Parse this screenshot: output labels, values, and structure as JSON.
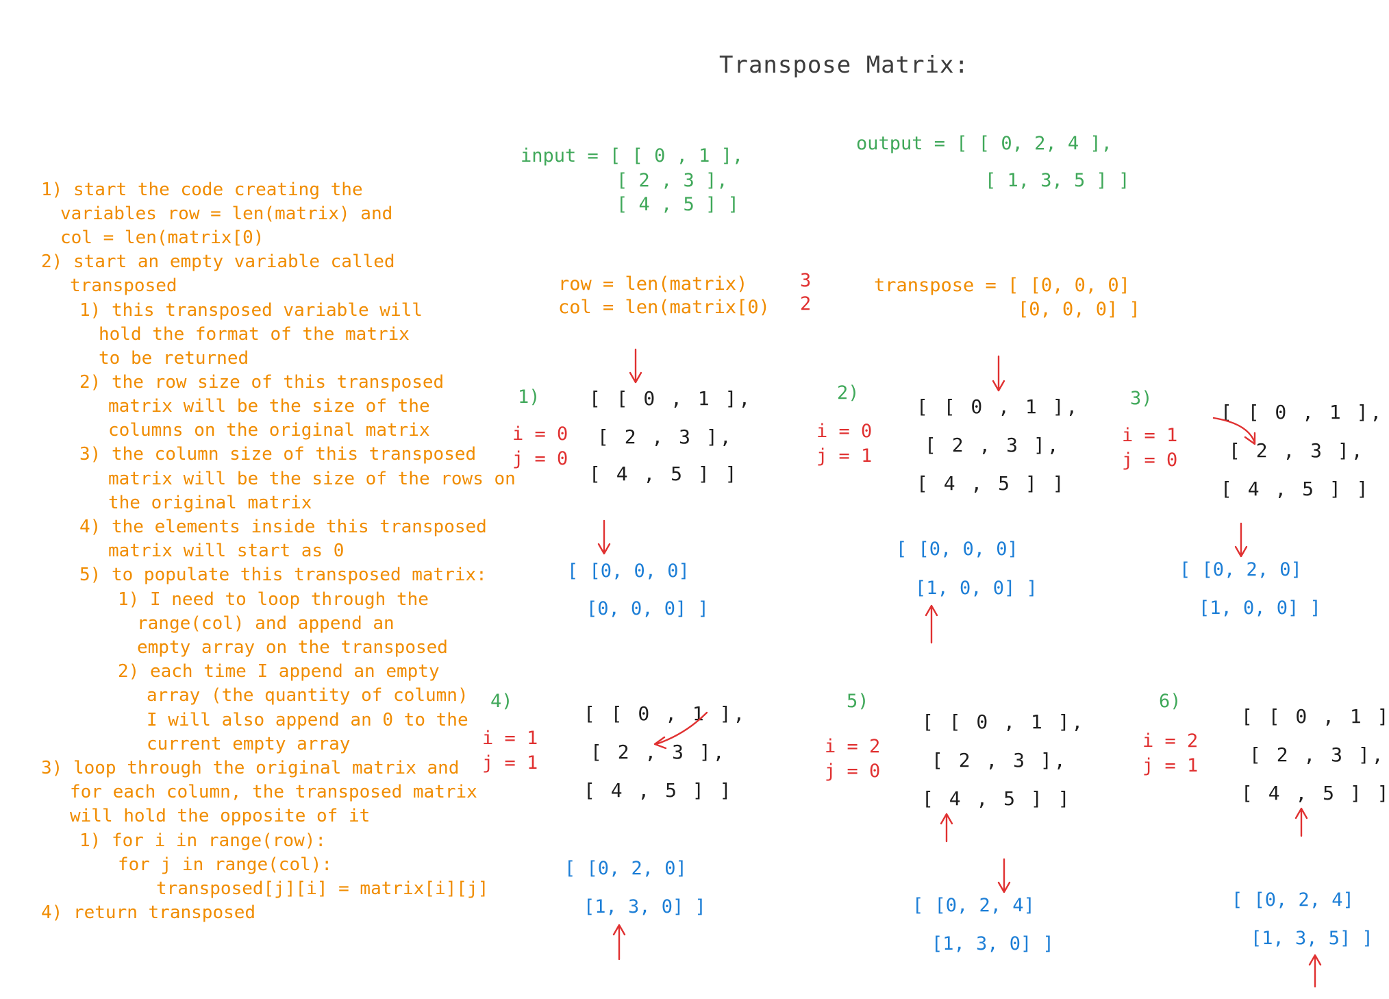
{
  "title": "Transpose Matrix:",
  "input": [
    "input = [ [ 0 , 1 ],",
    "[ 2 , 3 ],",
    "[ 4 , 5 ] ]"
  ],
  "output": [
    "output = [ [ 0, 2, 4 ],",
    "[ 1, 3, 5 ] ]"
  ],
  "rowcol": [
    "row = len(matrix)",
    "col = len(matrix[0)"
  ],
  "rowcol_values": [
    "3",
    "2"
  ],
  "transpose_init": [
    "transpose = [ [0, 0, 0]",
    "[0, 0, 0] ]"
  ],
  "notes": [
    "1) start the code creating the",
    "variables row = len(matrix) and",
    "col = len(matrix[0)",
    "2) start an empty variable called",
    "transposed",
    "1) this transposed variable will",
    "hold the format of the matrix",
    "to be returned",
    "2) the row size of this transposed",
    "matrix will be the size of the",
    "columns on the original matrix",
    "3) the column size of this transposed",
    "matrix will be the size of the rows on",
    "the original matrix",
    "4) the elements inside this transposed",
    "matrix will start as 0",
    "5) to populate this transposed matrix:",
    "1) I need to loop through the",
    "range(col) and append an",
    "empty array on the transposed",
    "2) each time I append an empty",
    "array (the quantity of column)",
    "I will also append an 0 to the",
    "current empty array",
    "3) loop through the original matrix and",
    "for each column, the transposed matrix",
    "will hold the opposite of it",
    "1) for i in range(row):",
    "for j in range(col):",
    "transposed[j][i] = matrix[i][j]",
    "4) return transposed"
  ],
  "matrix_rows": [
    "[ [ 0 , 1 ],",
    "[ 2 , 3 ],",
    "[ 4 , 5 ] ]"
  ],
  "steps": [
    {
      "label": "1)",
      "i": "i = 0",
      "j": "j = 0",
      "result": [
        "[ [0, 0, 0]",
        "[0, 0, 0] ]"
      ]
    },
    {
      "label": "2)",
      "i": "i = 0",
      "j": "j = 1",
      "result": [
        "[ [0, 0, 0]",
        "[1, 0, 0] ]"
      ]
    },
    {
      "label": "3)",
      "i": "i = 1",
      "j": "j = 0",
      "result": [
        "[ [0, 2, 0]",
        "[1, 0, 0] ]"
      ]
    },
    {
      "label": "4)",
      "i": "i = 1",
      "j": "j = 1",
      "result": [
        "[ [0, 2, 0]",
        "[1, 3, 0] ]"
      ]
    },
    {
      "label": "5)",
      "i": "i = 2",
      "j": "j = 0",
      "result": [
        "[ [0, 2, 4]",
        "[1, 3, 0] ]"
      ]
    },
    {
      "label": "6)",
      "i": "i = 2",
      "j": "j = 1",
      "result": [
        "[ [0, 2, 4]",
        "[1, 3, 5] ]"
      ]
    }
  ],
  "colors": {
    "orange": "#f08c00",
    "green": "#40a85a",
    "red": "#e03131",
    "blue": "#1c7ed6",
    "dark": "#1e1e1e"
  }
}
